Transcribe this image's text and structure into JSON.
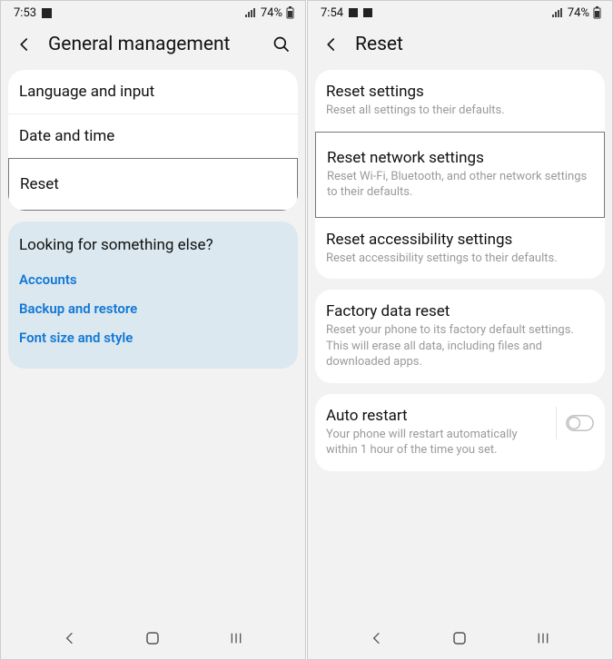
{
  "left": {
    "status": {
      "time": "7:53",
      "battery": "74%"
    },
    "header": {
      "title": "General management"
    },
    "items": {
      "lang": "Language and input",
      "date": "Date and time",
      "reset": "Reset"
    },
    "help": {
      "q": "Looking for something else?",
      "accounts": "Accounts",
      "backup": "Backup and restore",
      "font": "Font size and style"
    }
  },
  "right": {
    "status": {
      "time": "7:54",
      "battery": "74%"
    },
    "header": {
      "title": "Reset"
    },
    "reset_settings": {
      "title": "Reset settings",
      "sub": "Reset all settings to their defaults."
    },
    "reset_network": {
      "title": "Reset network settings",
      "sub": "Reset Wi-Fi, Bluetooth, and other network settings to their defaults."
    },
    "reset_access": {
      "title": "Reset accessibility settings",
      "sub": "Reset accessibility settings to their defaults."
    },
    "factory": {
      "title": "Factory data reset",
      "sub": "Reset your phone to its factory default settings. This will erase all data, including files and downloaded apps."
    },
    "auto_restart": {
      "title": "Auto restart",
      "sub": "Your phone will restart automatically within 1 hour of the time you set."
    }
  }
}
